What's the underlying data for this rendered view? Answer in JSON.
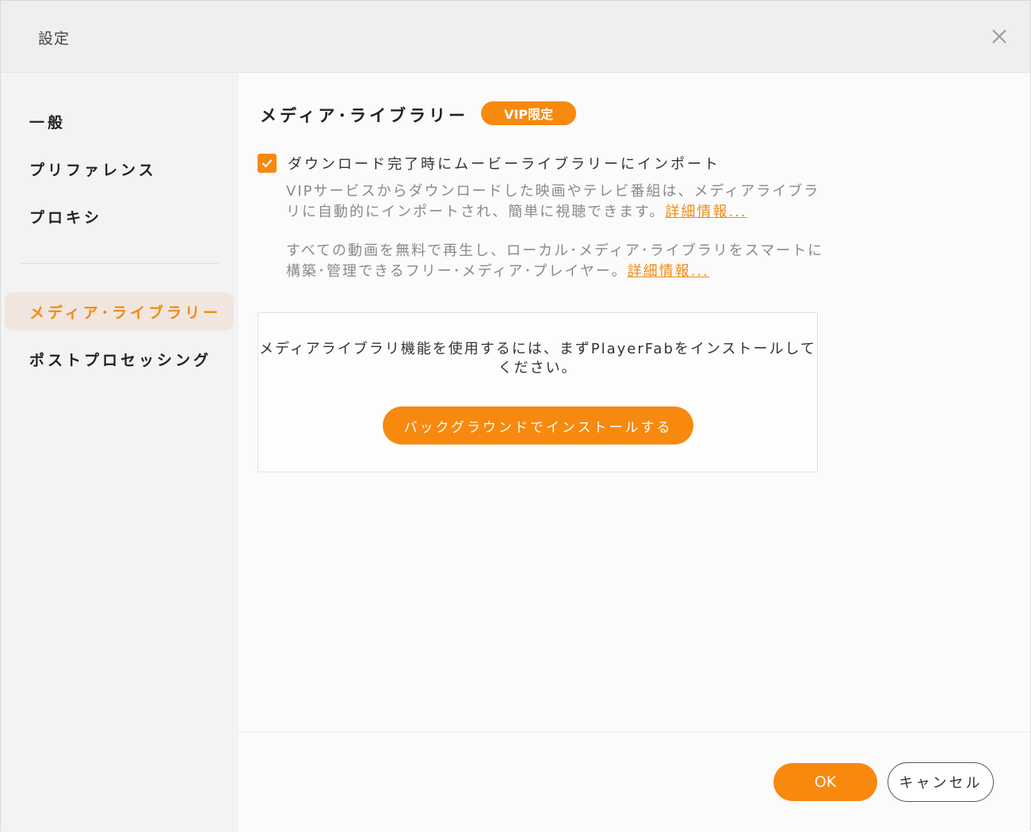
{
  "window": {
    "title": "設定"
  },
  "sidebar": {
    "items": [
      {
        "label": "一般",
        "active": false
      },
      {
        "label": "プリファレンス",
        "active": false
      },
      {
        "label": "プロキシ",
        "active": false
      },
      {
        "label": "メディア･ライブラリー",
        "active": true
      },
      {
        "label": "ポストプロセッシング",
        "active": false
      }
    ]
  },
  "main": {
    "section_title": "メディア･ライブラリー",
    "vip_badge": "VIP限定",
    "import_option": {
      "label": "ダウンロード完了時にムービーライブラリーにインポート",
      "checked": true
    },
    "desc1": {
      "text": "VIPサービスからダウンロードした映画やテレビ番組は、メディアライブラリに自動的にインポートされ、簡単に視聴できます。",
      "link": "詳細情報..."
    },
    "desc2": {
      "text": "すべての動画を無料で再生し、ローカル･メディア･ライブラリをスマートに構築･管理できるフリー･メディア･プレイヤー。",
      "link": "詳細情報..."
    },
    "install_box": {
      "message": "メディアライブラリ機能を使用するには、まずPlayerFabをインストールしてください。",
      "button_label": "バックグラウンドでインストールする"
    }
  },
  "footer": {
    "ok_label": "OK",
    "cancel_label": "キャンセル"
  },
  "colors": {
    "accent": "#f7890f",
    "active_item_bg": "#f0e6df"
  },
  "icons": {
    "close": "close-icon",
    "check": "checkmark-icon"
  }
}
